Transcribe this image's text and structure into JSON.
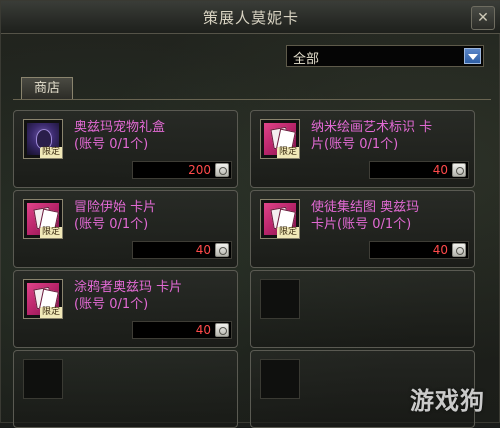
{
  "window": {
    "title": "策展人莫妮卡",
    "close_label": "✕"
  },
  "filter": {
    "selected": "全部"
  },
  "tabs": [
    {
      "label": "商店"
    }
  ],
  "items": [
    {
      "name": "奥兹玛宠物礼盒",
      "sub": "(账号 0/1个)",
      "tag": "限定",
      "price": "200",
      "art": "pet"
    },
    {
      "name": "纳米绘画艺术标识 卡",
      "sub": "片(账号 0/1个)",
      "tag": "限定",
      "price": "40",
      "art": "card"
    },
    {
      "name": "冒险伊始 卡片",
      "sub": "(账号 0/1个)",
      "tag": "限定",
      "price": "40",
      "art": "card"
    },
    {
      "name": "使徒集结图 奥兹玛",
      "sub": "卡片(账号 0/1个)",
      "tag": "限定",
      "price": "40",
      "art": "card"
    },
    {
      "name": "涂鸦者奥兹玛 卡片",
      "sub": "(账号 0/1个)",
      "tag": "限定",
      "price": "40",
      "art": "card"
    }
  ],
  "watermark": "游戏狗",
  "colors": {
    "item_name": "#e26ad4",
    "price": "#ff4a4a",
    "title_text": "#d8d3c2"
  }
}
